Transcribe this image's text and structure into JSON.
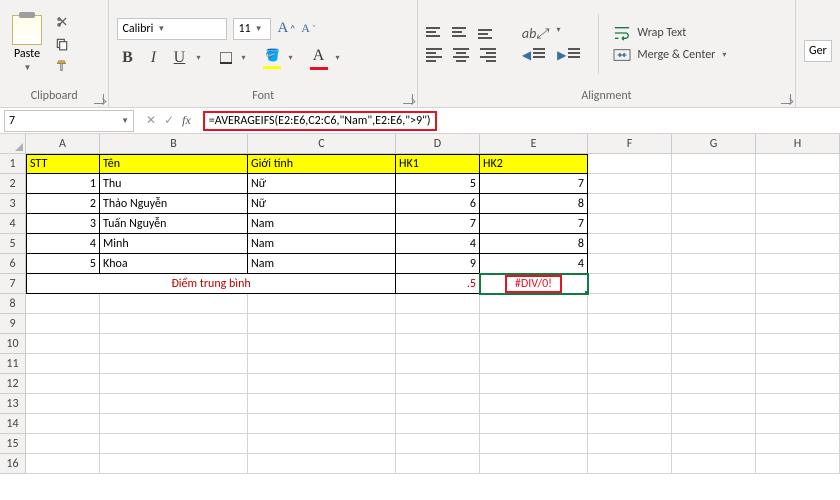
{
  "ribbon": {
    "clipboard": {
      "label": "Clipboard",
      "paste": "Paste"
    },
    "font": {
      "label": "Font",
      "name": "Calibri",
      "size": "11",
      "bold": "B",
      "italic": "I",
      "underline": "U"
    },
    "alignment": {
      "label": "Alignment",
      "wrap": "Wrap Text",
      "merge": "Merge & Center"
    },
    "number_label_truncated": "Ger"
  },
  "formula_bar": {
    "name_box": "7",
    "formula": "=AVERAGEIFS(E2:E6,C2:C6,\"Nam\",E2:E6,\">9\")"
  },
  "columns": [
    "A",
    "B",
    "C",
    "D",
    "E",
    "F",
    "G",
    "H"
  ],
  "table": {
    "headers": {
      "a": "STT",
      "b": "Tên",
      "c": "Giới tính",
      "d": "HK1",
      "e": "HK2"
    },
    "rows": [
      {
        "stt": "1",
        "ten": "Thu",
        "gt": "Nữ",
        "hk1": "5",
        "hk2": "7"
      },
      {
        "stt": "2",
        "ten": "Thảo Nguyễn",
        "gt": "Nữ",
        "hk1": "6",
        "hk2": "8"
      },
      {
        "stt": "3",
        "ten": "Tuấn Nguyễn",
        "gt": "Nam",
        "hk1": "7",
        "hk2": "7"
      },
      {
        "stt": "4",
        "ten": "Minh",
        "gt": "Nam",
        "hk1": "4",
        "hk2": "8"
      },
      {
        "stt": "5",
        "ten": "Khoa",
        "gt": "Nam",
        "hk1": "9",
        "hk2": "4"
      }
    ],
    "summary": {
      "label": "Điểm trung bình",
      "hk1": ".5",
      "hk2": "#DIV/0!"
    }
  }
}
